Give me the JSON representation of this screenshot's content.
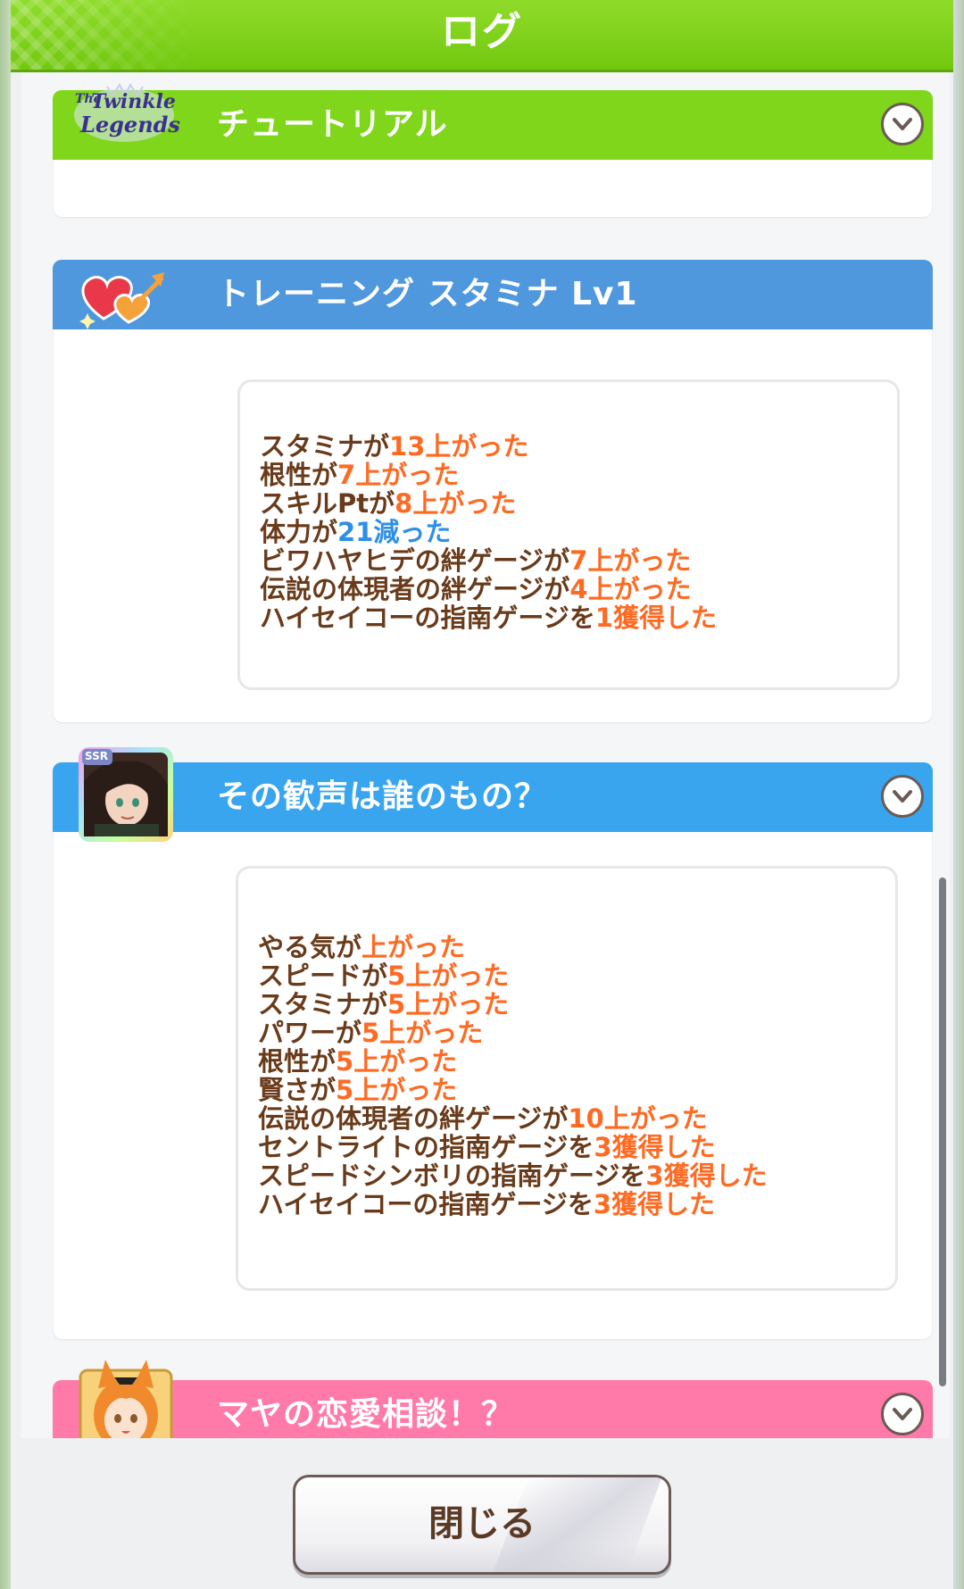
{
  "title": "ログ",
  "entries": [
    {
      "title": "チュートリアル",
      "icon": "twinkle-legends-logo",
      "logo_lines": [
        "The",
        "Twinkle",
        "Legends"
      ],
      "header_color": "#7fd61a",
      "lines": []
    },
    {
      "title": "トレーニング スタミナ Lv1",
      "icon": "hearts-arrow-icon",
      "header_color": "#4f98de",
      "lines": [
        {
          "prefix": "スタミナが",
          "value": "13",
          "suffix": "上がった",
          "color": "#ff6a22"
        },
        {
          "prefix": "根性が",
          "value": "7",
          "suffix": "上がった",
          "color": "#ff6a22"
        },
        {
          "prefix": "スキルPtが",
          "value": "8",
          "suffix": "上がった",
          "color": "#ff6a22"
        },
        {
          "prefix": "体力が",
          "value": "21",
          "suffix": "減った",
          "color": "#2e8fe6"
        },
        {
          "prefix": "ビワハヤヒデの絆ゲージが",
          "value": "7",
          "suffix": "上がった",
          "color": "#ff6a22"
        },
        {
          "prefix": "伝説の体現者の絆ゲージが",
          "value": "4",
          "suffix": "上がった",
          "color": "#ff6a22"
        },
        {
          "prefix": "ハイセイコーの指南ゲージを",
          "value": "1",
          "suffix": "獲得した",
          "color": "#ff6a22"
        }
      ]
    },
    {
      "title": "その歓声は誰のもの？",
      "icon": "ssr-support-card-portrait",
      "badge": "SSR",
      "header_color": "#3aa5ef",
      "lines": [
        {
          "prefix": "やる気が",
          "value": "",
          "suffix": "上がった",
          "color": "#ff6a22"
        },
        {
          "prefix": "スピードが",
          "value": "5",
          "suffix": "上がった",
          "color": "#ff6a22"
        },
        {
          "prefix": "スタミナが",
          "value": "5",
          "suffix": "上がった",
          "color": "#ff6a22"
        },
        {
          "prefix": "パワーが",
          "value": "5",
          "suffix": "上がった",
          "color": "#ff6a22"
        },
        {
          "prefix": "根性が",
          "value": "5",
          "suffix": "上がった",
          "color": "#ff6a22"
        },
        {
          "prefix": "賢さが",
          "value": "5",
          "suffix": "上がった",
          "color": "#ff6a22"
        },
        {
          "prefix": "伝説の体現者の絆ゲージが",
          "value": "10",
          "suffix": "上がった",
          "color": "#ff6a22"
        },
        {
          "prefix": "セントライトの指南ゲージを",
          "value": "3",
          "suffix": "獲得した",
          "color": "#ff6a22"
        },
        {
          "prefix": "スピードシンボリの指南ゲージを",
          "value": "3",
          "suffix": "獲得した",
          "color": "#ff6a22"
        },
        {
          "prefix": "ハイセイコーの指南ゲージを",
          "value": "3",
          "suffix": "獲得した",
          "color": "#ff6a22"
        }
      ]
    },
    {
      "title": "マヤの恋愛相談！？",
      "icon": "character-portrait-maya",
      "header_color": "#ff7aa8",
      "lines": []
    }
  ],
  "close_button": {
    "label": "閉じる"
  },
  "colors": {
    "title_bar": "#7ccf1a",
    "text_brown": "#6a3b1a",
    "value_orange": "#ff6a22",
    "value_blue": "#2e8fe6"
  }
}
